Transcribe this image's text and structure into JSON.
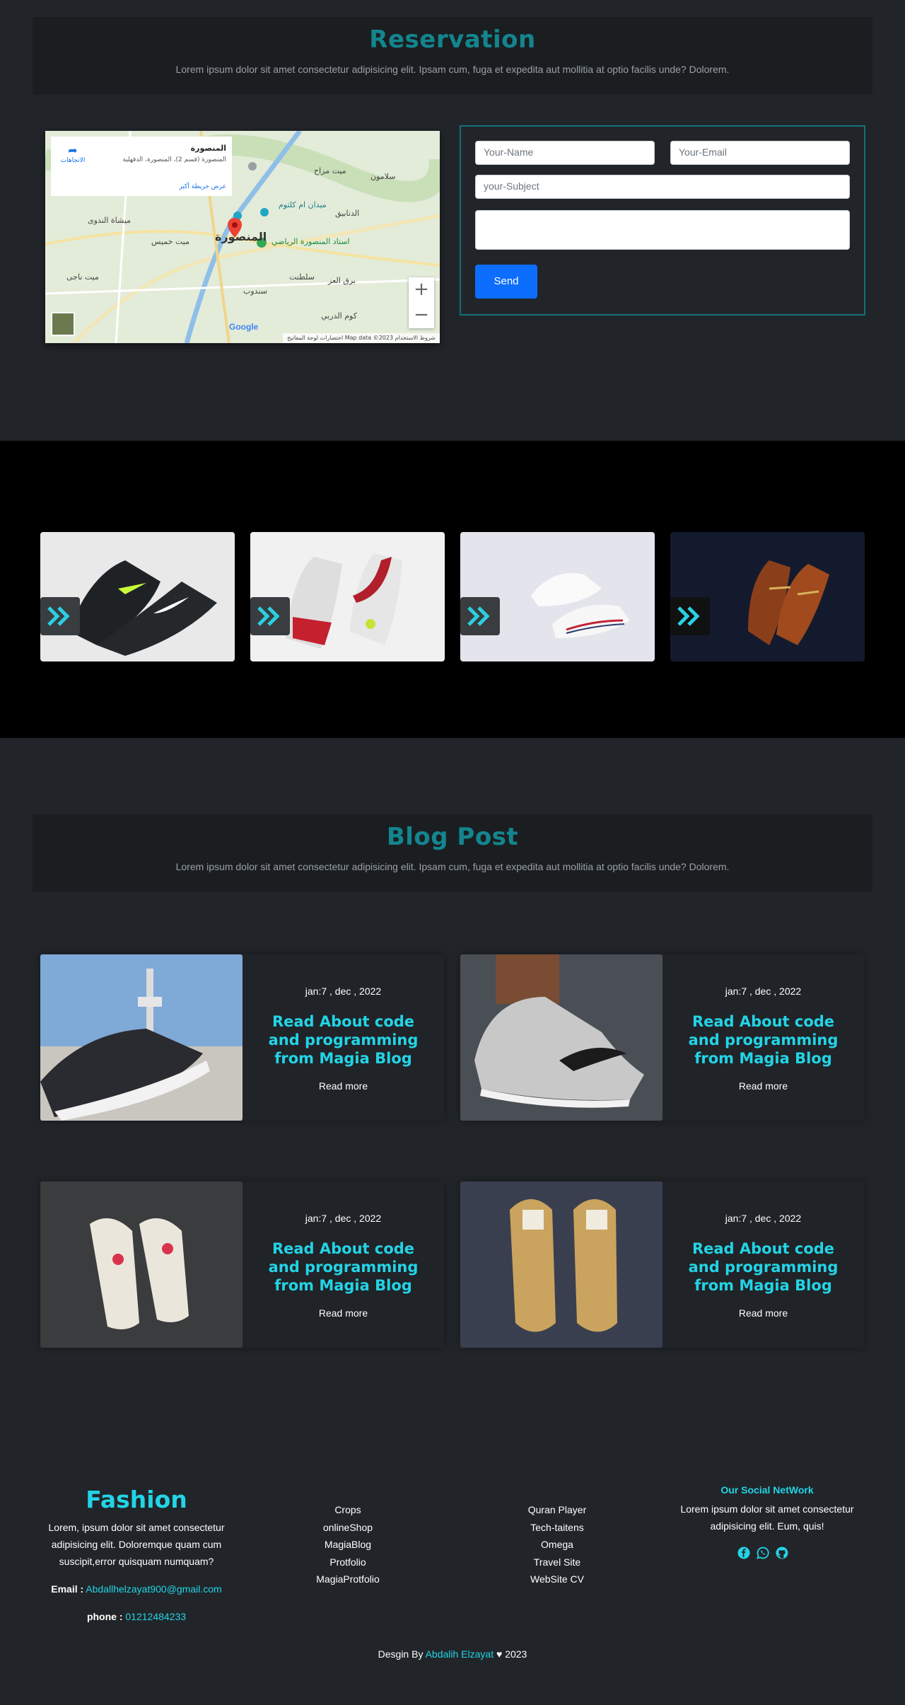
{
  "reservation": {
    "title": "Reservation",
    "subtitle": "Lorem ipsum dolor sit amet consectetur adipisicing elit. Ipsam cum, fuga et expedita aut mollitia at optio facilis unde? Dolorem."
  },
  "map": {
    "place_name": "المنصورة",
    "place_address": "المنصورة (قسم 2)، المنصورة، الدقهلية",
    "larger_map_link": "عرض خريطة أكبر",
    "directions_label": "الاتجاهات",
    "zoom_in": "+",
    "zoom_out": "−",
    "google_logo": "Google",
    "footer": "اختصارات لوحة المفاتيح   Map data ©2023   شروط الاستخدام"
  },
  "form": {
    "name_placeholder": "Your-Name",
    "email_placeholder": "Your-Email",
    "subject_placeholder": "your-Subject",
    "message_placeholder": "",
    "send_label": "Send"
  },
  "gallery": {
    "items": [
      {
        "icon": "chevron-double-right-icon"
      },
      {
        "icon": "chevron-double-right-icon"
      },
      {
        "icon": "chevron-double-right-icon"
      },
      {
        "icon": "chevron-double-right-icon"
      }
    ]
  },
  "blog": {
    "title": "Blog Post",
    "subtitle": "Lorem ipsum dolor sit amet consectetur adipisicing elit. Ipsam cum, fuga et expedita aut mollitia at optio facilis unde? Dolorem.",
    "posts": [
      {
        "date": "jan:7 , dec , 2022",
        "title": "Read About code and programming from Magia Blog",
        "link": "Read more"
      },
      {
        "date": "jan:7 , dec , 2022",
        "title": "Read About code and programming from Magia Blog",
        "link": "Read more"
      },
      {
        "date": "jan:7 , dec , 2022",
        "title": "Read About code and programming from Magia Blog",
        "link": "Read more"
      },
      {
        "date": "jan:7 , dec , 2022",
        "title": "Read About code and programming from Magia Blog",
        "link": "Read more"
      }
    ]
  },
  "footer": {
    "brand": "Fashion",
    "description": "Lorem, ipsum dolor sit amet consectetur adipisicing elit. Doloremque quam cum suscipit,error quisquam numquam?",
    "email_label": "Email :",
    "email": "Abdallhelzayat900@gmail.com",
    "phone_label": "phone :",
    "phone": "01212484233",
    "links_col1": [
      "Crops",
      "onlineShop",
      "MagiaBlog",
      "Protfolio",
      "MagiaProtfolio"
    ],
    "links_col2": [
      "Quran Player",
      "Tech-taitens",
      "Omega",
      "Travel Site",
      "WebSite CV"
    ],
    "social_title": "Our Social NetWork",
    "social_text": "Lorem ipsum dolor sit amet consectetur adipisicing elit. Eum, quis!",
    "copyright_prefix": "Desgin By",
    "copyright_author": "Abdalih Elzayat",
    "copyright_year": "2023",
    "colors": {
      "accent": "#22d4e6",
      "heading": "#13858f",
      "button": "#0d6efd"
    }
  }
}
